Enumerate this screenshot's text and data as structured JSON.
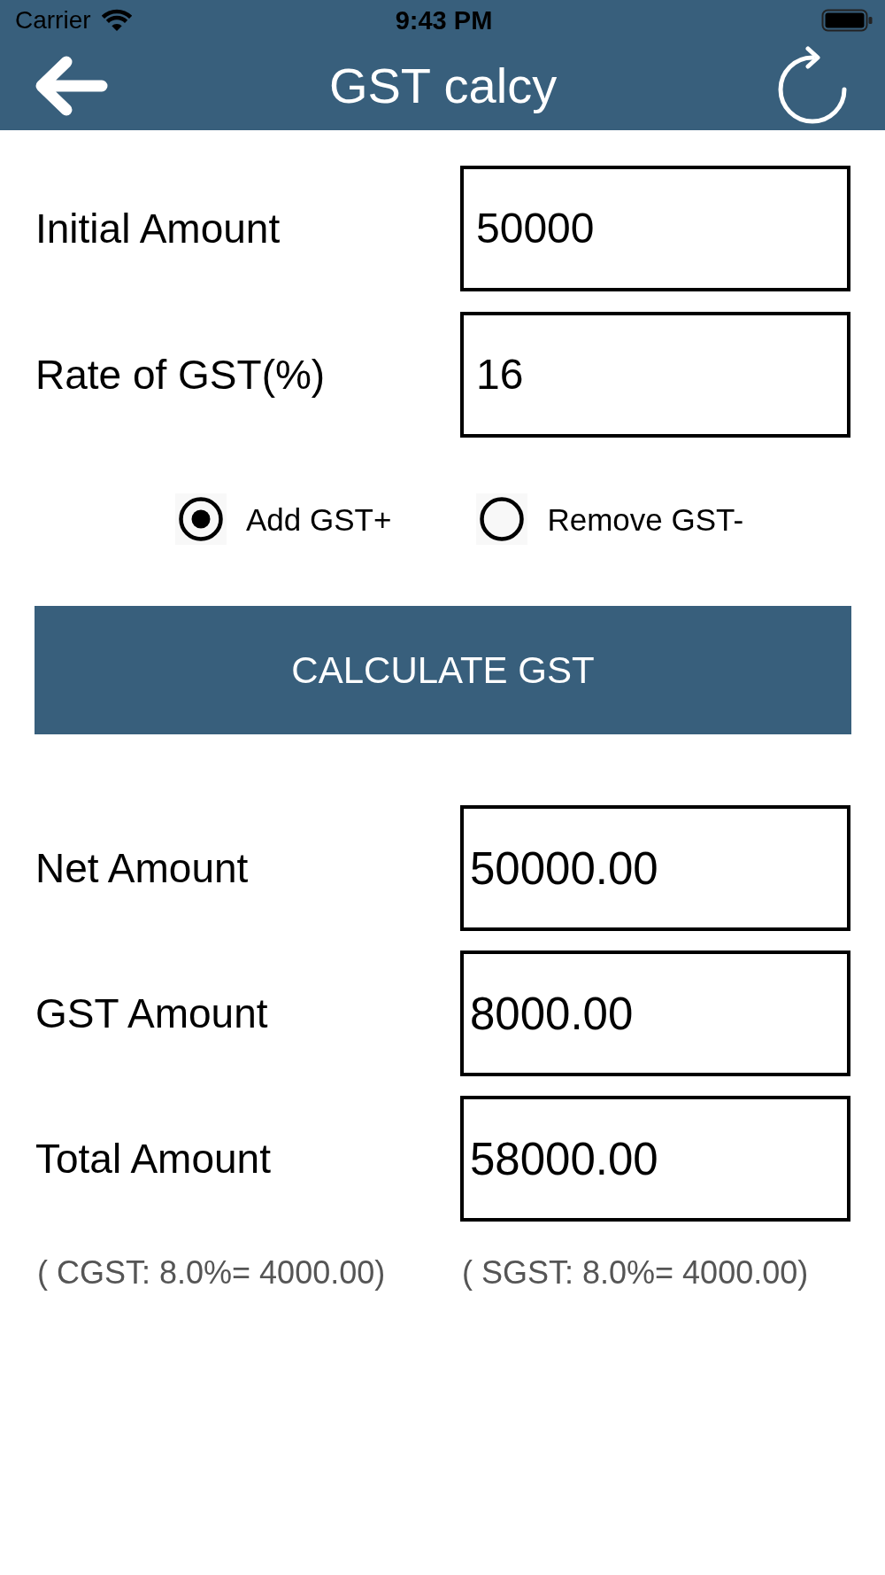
{
  "status_bar": {
    "carrier": "Carrier",
    "time": "9:43 PM"
  },
  "nav_bar": {
    "title": "GST calcy"
  },
  "inputs": [
    {
      "label": "Initial Amount",
      "value": "50000"
    },
    {
      "label": "Rate of GST(%)",
      "value": "16"
    }
  ],
  "gst_mode": [
    {
      "label": "Add GST+",
      "selected": true
    },
    {
      "label": "Remove GST-",
      "selected": false
    }
  ],
  "calculate_button": {
    "label": "CALCULATE GST"
  },
  "results": [
    {
      "label": "Net Amount",
      "value": "50000.00"
    },
    {
      "label": "GST Amount",
      "value": "8000.00"
    },
    {
      "label": "Total Amount",
      "value": "58000.00"
    }
  ],
  "breakdown": [
    "( CGST: 8.0%= 4000.00)",
    "( SGST: 8.0%= 4000.00)"
  ]
}
